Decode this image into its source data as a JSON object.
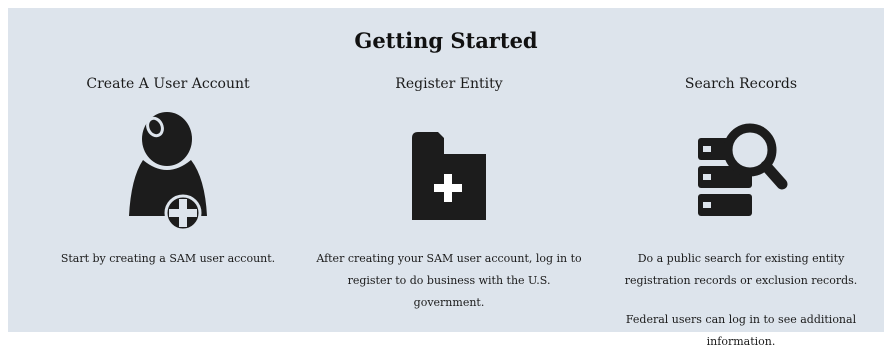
{
  "section": {
    "title": "Getting Started"
  },
  "cards": [
    {
      "title": "Create A User Account",
      "icon": "user-add-icon",
      "description": "Start by creating a SAM user account."
    },
    {
      "title": "Register Entity",
      "icon": "folder-add-icon",
      "description": "After creating your SAM user account, log in to register to do business with the U.S. government."
    },
    {
      "title": "Search Records",
      "icon": "search-records-icon",
      "description": "Do a public search for existing entity registration records or exclusion records.",
      "note": "Federal users can log in to see additional information."
    }
  ],
  "colors": {
    "background": "#dde4ec",
    "icon": "#1c1c1c"
  }
}
